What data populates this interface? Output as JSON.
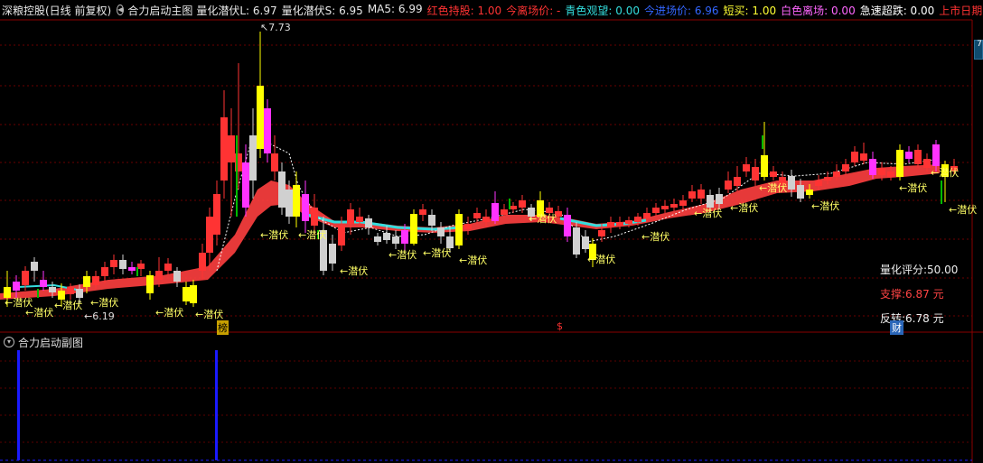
{
  "header": {
    "stock": "深粮控股(日线 前复权)",
    "main_indicator": "合力启动主图",
    "items": [
      {
        "label": "量化潜伏L:",
        "value": "6.97",
        "color": "#e8e8e8"
      },
      {
        "label": "量化潜伏S:",
        "value": "6.95",
        "color": "#e8e8e8"
      },
      {
        "label": "MA5:",
        "value": "6.99",
        "color": "#e8e8e8"
      },
      {
        "label": "红色持股:",
        "value": "1.00",
        "color": "#ff3333"
      },
      {
        "label": "今离场价:",
        "value": "-",
        "color": "#ff3333"
      },
      {
        "label": "青色观望:",
        "value": "0.00",
        "color": "#33dddd"
      },
      {
        "label": "今进场价:",
        "value": "6.96",
        "color": "#3366ff"
      },
      {
        "label": "短买:",
        "value": "1.00",
        "color": "#ffff33"
      },
      {
        "label": "白色离场:",
        "value": "0.00",
        "color": "#ff66ff"
      },
      {
        "label": "急速超跌:",
        "value": "0.00",
        "color": "#ffffff"
      },
      {
        "label": "上市日期:",
        "value": "",
        "color": "#ff3333"
      }
    ]
  },
  "sub_indicator": "合力启动副图",
  "annotations": {
    "high_price": "7.73",
    "low_price": "6.19",
    "qianfu": "←潜伏",
    "bang_mark": "榜",
    "s_mark": "$",
    "cai_mark": "财",
    "right_scroll": "7"
  },
  "info_panel": {
    "score_label": "量化评分:",
    "score_value": "50.00",
    "support_label": "支撑:",
    "support_value": "6.87 元",
    "reverse_label": "反转:",
    "reverse_value": "6.78 元"
  },
  "colors": {
    "red": "#ff3333",
    "yellow": "#ffff00",
    "magenta": "#ff33ff",
    "white": "#d0d0d0",
    "green": "#00bb00",
    "cyan": "#33dddd",
    "blue": "#1a1aff"
  }
}
